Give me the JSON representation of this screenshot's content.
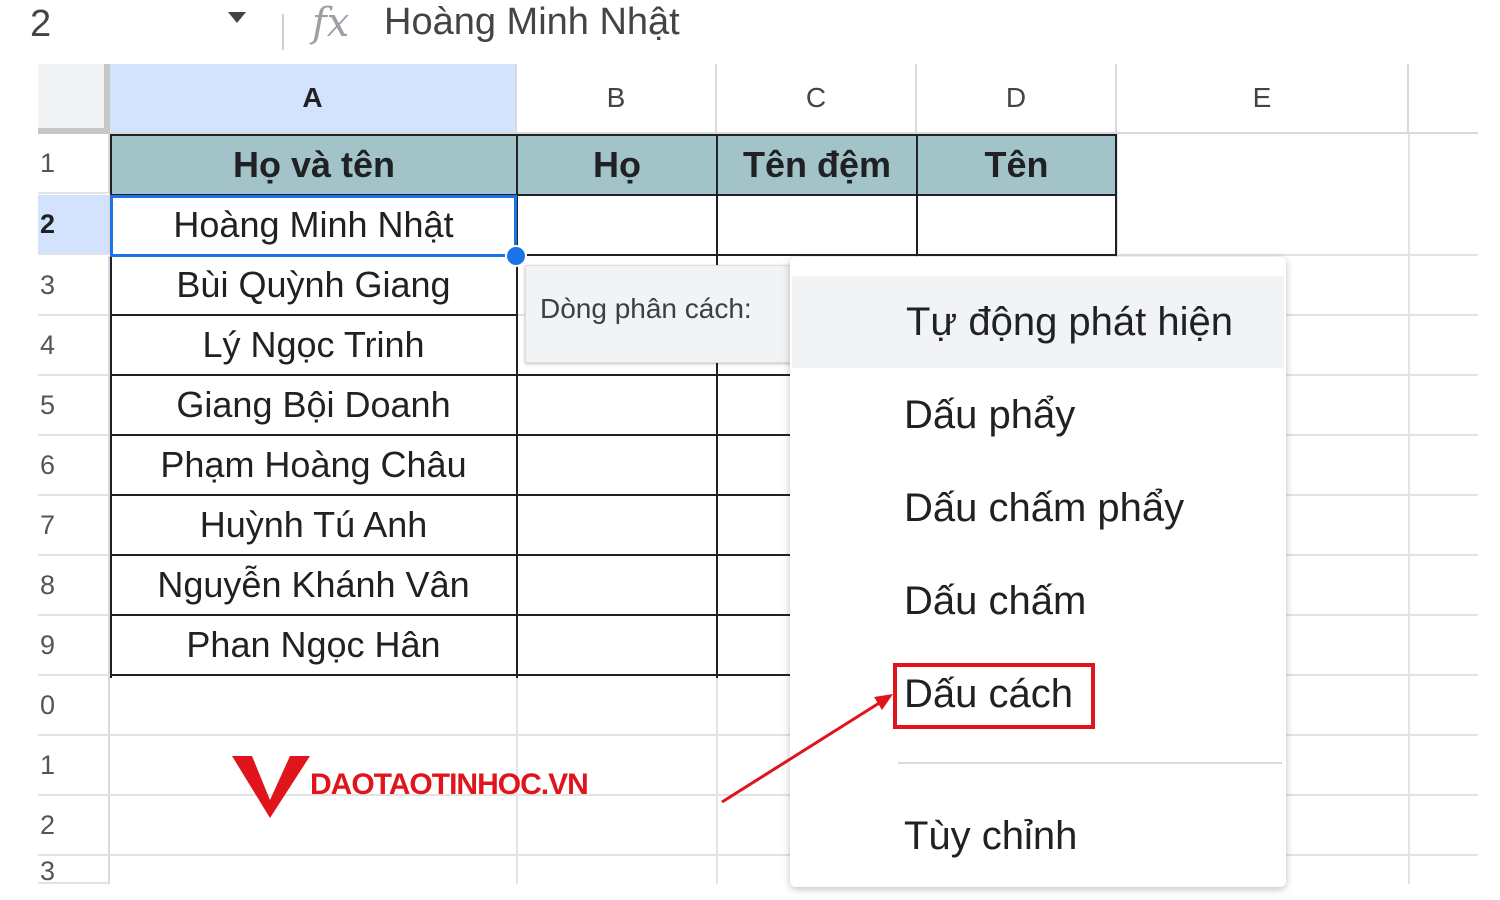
{
  "formula_bar": {
    "name_box": "2",
    "fx_symbol": "fx",
    "value": "Hoàng Minh Nhật"
  },
  "columns": [
    "A",
    "B",
    "C",
    "D",
    "E"
  ],
  "rows": [
    "1",
    "2",
    "3",
    "4",
    "5",
    "6",
    "7",
    "8",
    "9",
    "0",
    "1",
    "2",
    "3"
  ],
  "headers": {
    "a": "Họ và tên",
    "b": "Họ",
    "c": "Tên đệm",
    "d": "Tên"
  },
  "names": [
    "Hoàng Minh Nhật",
    "Bùi Quỳnh Giang",
    "Lý Ngọc Trinh",
    "Giang Bội Doanh",
    "Phạm Hoàng Châu",
    "Huỳnh Tú Anh",
    "Nguyễn Khánh Vân",
    "Phan Ngọc Hân"
  ],
  "split_panel": {
    "label": "Dòng phân cách:"
  },
  "separator_menu": {
    "items": [
      "Tự động phát hiện",
      "Dấu phẩy",
      "Dấu chấm phẩy",
      "Dấu chấm",
      "Dấu cách",
      "Tùy chỉnh"
    ],
    "hovered": "Tự động phát hiện",
    "highlighted": "Dấu cách"
  },
  "watermark": {
    "text": "DAOTAOTINHOC.VN"
  },
  "colors": {
    "header_fill": "#a2c4c9",
    "selection": "#1a73e8",
    "annotation": "#e0151b",
    "active_header": "#d3e3fd"
  }
}
